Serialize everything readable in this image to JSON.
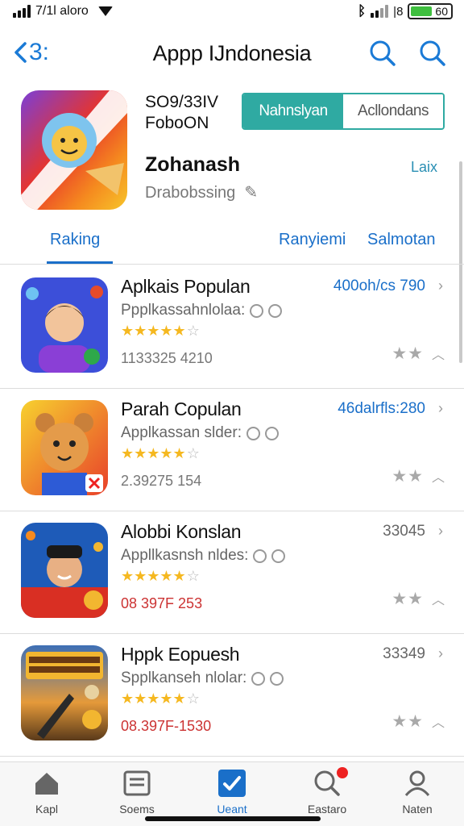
{
  "status_bar": {
    "carrier": "7/1l aloro",
    "battery": "60"
  },
  "header": {
    "back_label": "3:",
    "title": "Appp IJndonesia"
  },
  "hero": {
    "meta_line1": "SO9/33IV",
    "meta_line2": "FoboON",
    "segment": [
      "Nahnslyan",
      "Acllondans"
    ],
    "name": "Zohanash",
    "subtitle": "Drabobssing",
    "link": "Laix"
  },
  "tabs": [
    "Raking",
    "Ranyiemi",
    "Salmotan"
  ],
  "items": [
    {
      "title": "Aplkais Populan",
      "subtitle": "Ppplkassahnlolaa:",
      "count": "1133325 4210",
      "price": "400oh/cs 790",
      "rating": 4.5
    },
    {
      "title": "Parah Copulan",
      "subtitle": "Applkassan slder:",
      "count": "2.39275 154",
      "price": "46dalrfls:280",
      "rating": 5
    },
    {
      "title": "Alobbi Konslan",
      "subtitle": "Appllkasnsh nldes:",
      "count": "08 397F 253",
      "price": "33045",
      "rating": 5
    },
    {
      "title": "Hppk Eopuesh",
      "subtitle": "Spplkanseh nlolar:",
      "count": "08.397F-1530",
      "price": "33349",
      "rating": 5
    }
  ],
  "bottom_nav": [
    "Kapl",
    "Soems",
    "Ueant",
    "Eastaro",
    "Naten"
  ],
  "colors": {
    "accent": "#1a6fc9",
    "segment": "#2faaa2",
    "star": "#f5b820"
  }
}
